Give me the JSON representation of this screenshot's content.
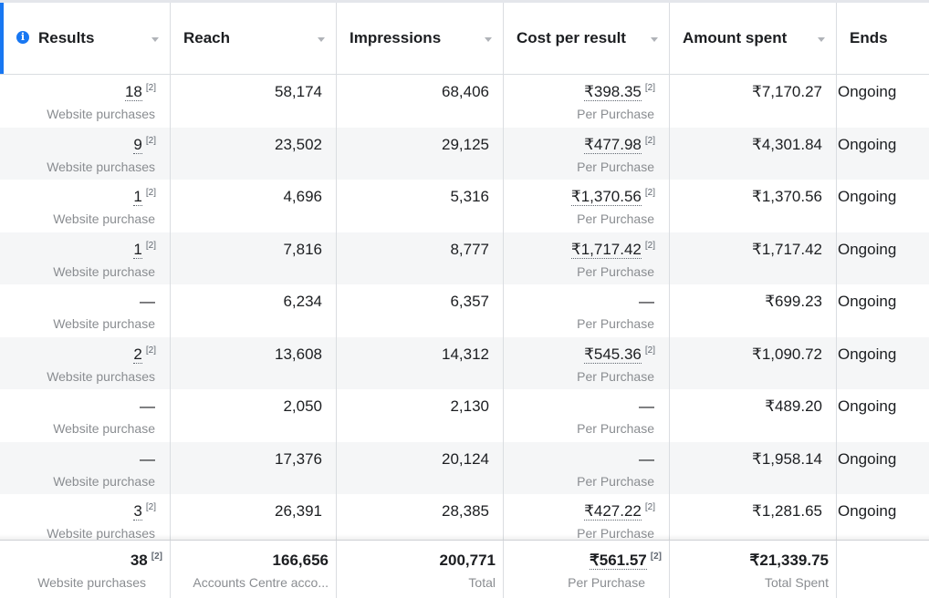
{
  "columns": {
    "results": "Results",
    "reach": "Reach",
    "impressions": "Impressions",
    "cost_per_result": "Cost per result",
    "amount_spent": "Amount spent",
    "ends": "Ends"
  },
  "rows": [
    {
      "results": "18",
      "results_sup": "[2]",
      "results_sub": "Website purchases",
      "reach": "58,174",
      "impressions": "68,406",
      "cost": "₹398.35",
      "cost_sup": "[2]",
      "cost_sub": "Per Purchase",
      "spent": "₹7,170.27",
      "ends": "Ongoing"
    },
    {
      "results": "9",
      "results_sup": "[2]",
      "results_sub": "Website purchases",
      "reach": "23,502",
      "impressions": "29,125",
      "cost": "₹477.98",
      "cost_sup": "[2]",
      "cost_sub": "Per Purchase",
      "spent": "₹4,301.84",
      "ends": "Ongoing"
    },
    {
      "results": "1",
      "results_sup": "[2]",
      "results_sub": "Website purchase",
      "reach": "4,696",
      "impressions": "5,316",
      "cost": "₹1,370.56",
      "cost_sup": "[2]",
      "cost_sub": "Per Purchase",
      "spent": "₹1,370.56",
      "ends": "Ongoing"
    },
    {
      "results": "1",
      "results_sup": "[2]",
      "results_sub": "Website purchase",
      "reach": "7,816",
      "impressions": "8,777",
      "cost": "₹1,717.42",
      "cost_sup": "[2]",
      "cost_sub": "Per Purchase",
      "spent": "₹1,717.42",
      "ends": "Ongoing"
    },
    {
      "results": "—",
      "results_sup": "",
      "results_sub": "Website purchase",
      "reach": "6,234",
      "impressions": "6,357",
      "cost": "—",
      "cost_sup": "",
      "cost_sub": "Per Purchase",
      "spent": "₹699.23",
      "ends": "Ongoing"
    },
    {
      "results": "2",
      "results_sup": "[2]",
      "results_sub": "Website purchases",
      "reach": "13,608",
      "impressions": "14,312",
      "cost": "₹545.36",
      "cost_sup": "[2]",
      "cost_sub": "Per Purchase",
      "spent": "₹1,090.72",
      "ends": "Ongoing"
    },
    {
      "results": "—",
      "results_sup": "",
      "results_sub": "Website purchase",
      "reach": "2,050",
      "impressions": "2,130",
      "cost": "—",
      "cost_sup": "",
      "cost_sub": "Per Purchase",
      "spent": "₹489.20",
      "ends": "Ongoing"
    },
    {
      "results": "—",
      "results_sup": "",
      "results_sub": "Website purchase",
      "reach": "17,376",
      "impressions": "20,124",
      "cost": "—",
      "cost_sup": "",
      "cost_sub": "Per Purchase",
      "spent": "₹1,958.14",
      "ends": "Ongoing"
    },
    {
      "results": "3",
      "results_sup": "[2]",
      "results_sub": "Website purchases",
      "reach": "26,391",
      "impressions": "28,385",
      "cost": "₹427.22",
      "cost_sup": "[2]",
      "cost_sub": "Per Purchase",
      "spent": "₹1,281.65",
      "ends": "Ongoing"
    }
  ],
  "totals": {
    "results": "38",
    "results_sup": "[2]",
    "results_sub": "Website purchases",
    "reach": "166,656",
    "reach_sub": "Accounts Centre acco...",
    "impressions": "200,771",
    "impressions_sub": "Total",
    "cost": "₹561.57",
    "cost_sup": "[2]",
    "cost_sub": "Per Purchase",
    "spent": "₹21,339.75",
    "spent_sub": "Total Spent"
  },
  "icons": {
    "results_info": "info-icon",
    "sort": "sort-caret-icon"
  },
  "colors": {
    "accent": "#1877f2",
    "alt_row": "#f5f6f7",
    "border": "#dadde1"
  }
}
